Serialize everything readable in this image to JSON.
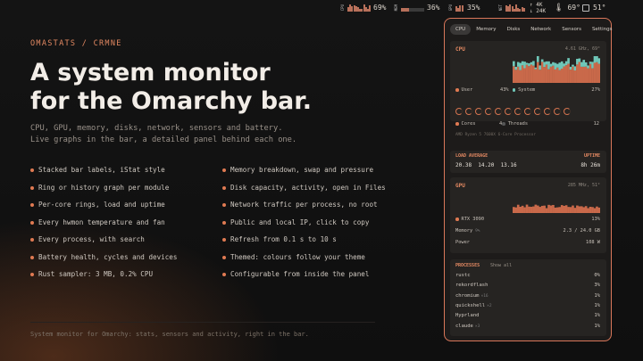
{
  "topbar": {
    "cpu": {
      "label": "CPU",
      "pct": "69%"
    },
    "mem": {
      "label": "MEM",
      "pct": "36%"
    },
    "gpu": {
      "label": "GPU",
      "pct": "35%"
    },
    "net": {
      "label": "NET",
      "up": "↑ 4K",
      "down": "↓ 24K"
    },
    "temp1": "69°",
    "temp2": "51°"
  },
  "brand": "OMASTATS / CRMNE",
  "headline": [
    "A system monitor",
    "for the Omarchy bar."
  ],
  "subtitle": [
    "CPU, GPU, memory, disks, network, sensors and battery.",
    "Live graphs in the bar, a detailed panel behind each one."
  ],
  "features_left": [
    "Stacked bar labels, iStat style",
    "Ring or history graph per module",
    "Per-core rings, load and uptime",
    "Every hwmon temperature and fan",
    "Every process, with search",
    "Battery health, cycles and devices",
    "Rust sampler: 3 MB, 0.2% CPU"
  ],
  "features_right": [
    "Memory breakdown, swap and pressure",
    "Disk capacity, activity, open in Files",
    "Network traffic per process, no root",
    "Public and local IP, click to copy",
    "Refresh from 0.1 s to 10 s",
    "Themed: colours follow your theme",
    "Configurable from inside the panel"
  ],
  "footer": "System monitor for Omarchy: stats, sensors and activity, right in the bar.",
  "panel": {
    "tabs": [
      "CPU",
      "Memory",
      "Disks",
      "Network",
      "Sensors",
      "Settings"
    ],
    "active_tab": "CPU",
    "cpu": {
      "title": "CPU",
      "meta": "4.61 GHz, 69°",
      "user_label": "User",
      "user_val": "43%",
      "system_label": "System",
      "system_val": "27%",
      "cores_label": "Cores",
      "cores_val": "4",
      "threads_label": "Threads",
      "threads_val": "12",
      "model": "AMD Ryzen 5 7600X 6-Core Processor"
    },
    "load": {
      "title": "LOAD AVERAGE",
      "values": "20.38  14.20  13.16",
      "uptime_title": "UPTIME",
      "uptime": "8h 26m"
    },
    "gpu": {
      "title": "GPU",
      "meta": "285 MHz, 51°",
      "name": "RTX 3090",
      "name_val": "13%",
      "mem_label": "Memory",
      "mem_sub": "9%",
      "mem_val": "2.3 / 24.0 GB",
      "power_label": "Power",
      "power_val": "108 W"
    },
    "processes": {
      "title": "PROCESSES",
      "show_all": "Show all",
      "items": [
        {
          "name": "rustc",
          "count": "",
          "val": "0%"
        },
        {
          "name": "rekordflash",
          "count": "",
          "val": "3%"
        },
        {
          "name": "chromium",
          "count": "×16",
          "val": "1%"
        },
        {
          "name": "quickshell",
          "count": "×2",
          "val": "1%"
        },
        {
          "name": "Hyprland",
          "count": "",
          "val": "1%"
        },
        {
          "name": "claude",
          "count": "×3",
          "val": "1%"
        }
      ]
    }
  },
  "colors": {
    "accent": "#e07a52",
    "teal": "#6fc7b8",
    "panel_border": "#d9775a"
  }
}
